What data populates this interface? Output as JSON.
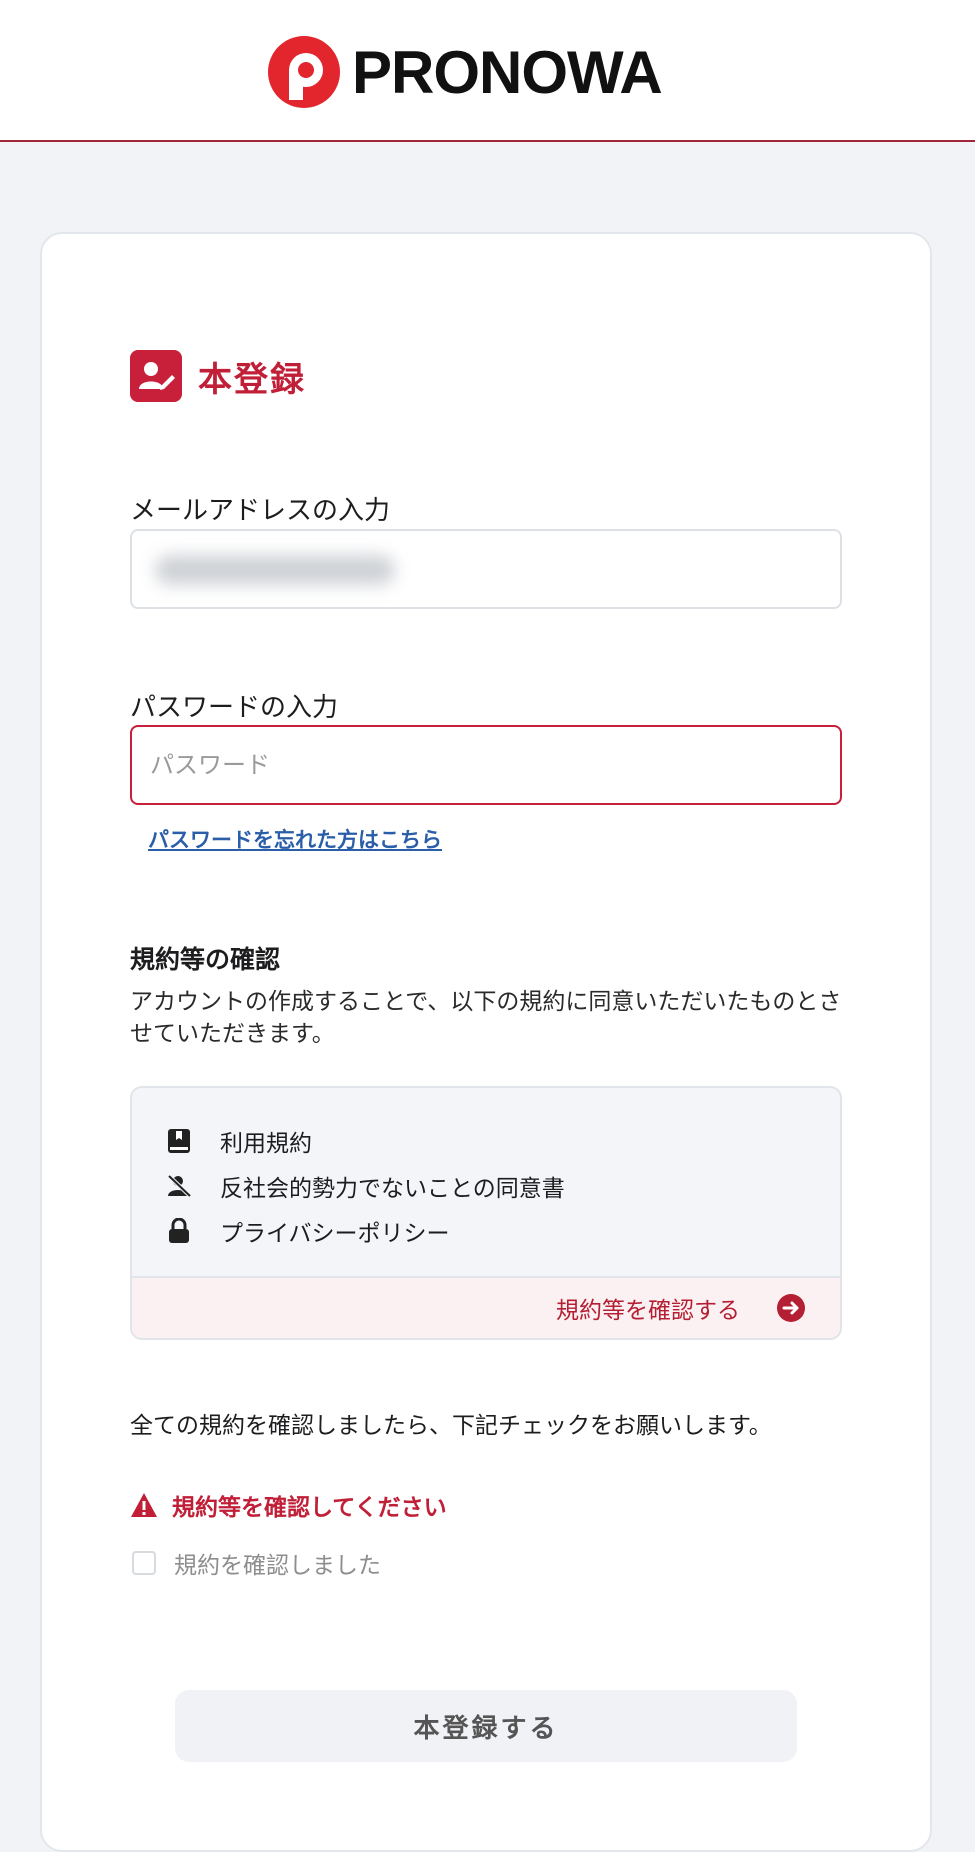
{
  "header": {
    "logo_text": "PRONOWA"
  },
  "page": {
    "title": "本登録"
  },
  "email": {
    "label": "メールアドレスの入力",
    "value": ""
  },
  "password": {
    "label": "パスワードの入力",
    "placeholder": "パスワード",
    "forgot_link": "パスワードを忘れた方はこちら"
  },
  "terms": {
    "section_title": "規約等の確認",
    "description": "アカウントの作成することで、以下の規約に同意いただいたものとさせていただきます。",
    "items": [
      {
        "icon": "book-icon",
        "label": "利用規約"
      },
      {
        "icon": "user-slash-icon",
        "label": "反社会的勢力でないことの同意書"
      },
      {
        "icon": "lock-icon",
        "label": "プライバシーポリシー"
      }
    ],
    "confirm_link": "規約等を確認する"
  },
  "note": "全ての規約を確認しましたら、下記チェックをお願いします。",
  "warning": "規約等を確認してください",
  "checkbox": {
    "label": "規約を確認しました",
    "checked": false
  },
  "submit_label": "本登録する",
  "colors": {
    "brand": "#c8203b",
    "link": "#2a5ea8",
    "background": "#f1f3f6"
  }
}
